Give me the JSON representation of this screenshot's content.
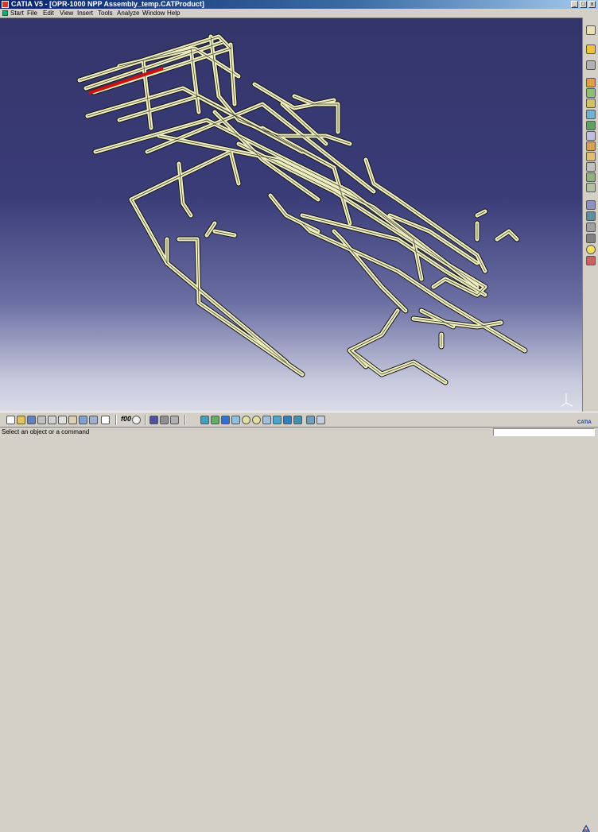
{
  "window": {
    "title": "CATIA V5 - [OPR-1000 NPP Assembly_temp.CATProduct]",
    "controls": {
      "minimize": "_",
      "maximize": "□",
      "close": "x"
    }
  },
  "menu": {
    "start": "Start",
    "file": "File",
    "edit": "Edit",
    "view": "View",
    "insert": "Insert",
    "tools": "Tools",
    "analyze": "Analyze",
    "window": "Window",
    "help": "Help"
  },
  "toolbar": {
    "f00_label": "f00",
    "bottom_icons": [
      "new-icon",
      "open-icon",
      "save-icon",
      "quick-print-icon",
      "cut-icon",
      "copy-icon",
      "paste-icon",
      "undo-icon",
      "redo-icon",
      "whats-this-icon",
      "formula-icon",
      "knowledge-icon",
      "catalog-icon",
      "measure-icon",
      "section-icon",
      "fly-mode-icon",
      "fit-all-icon",
      "pan-icon",
      "rotate-icon",
      "zoom-in-icon",
      "zoom-out-icon",
      "normal-view-icon",
      "multi-view-icon",
      "iso-view-icon",
      "shading-icon",
      "hide-show-icon",
      "swap-visible-icon"
    ],
    "right_icons": [
      "select-icon",
      "compass-icon",
      "product-icon",
      "component-icon",
      "part-icon",
      "existing-component-icon",
      "replace-icon",
      "graph-tree-icon",
      "generate-numbering-icon",
      "selective-load-icon",
      "manage-representations-icon",
      "multi-instantiation-icon",
      "fast-multi-instantiation-icon",
      "reorder-icon",
      "bill-of-material-icon",
      "clash-icon",
      "sectioning-icon",
      "distance-icon",
      "light-bulb-icon",
      "disable-icon"
    ]
  },
  "statusbar": {
    "message": "Select an object or a command",
    "command_input": ""
  },
  "viewport": {
    "background_top": "#34356a",
    "background_bottom": "#dcdde8",
    "pipe_color": "#eeeec0",
    "highlight_color": "#cc1111"
  },
  "logo": {
    "text": "CATIA"
  }
}
